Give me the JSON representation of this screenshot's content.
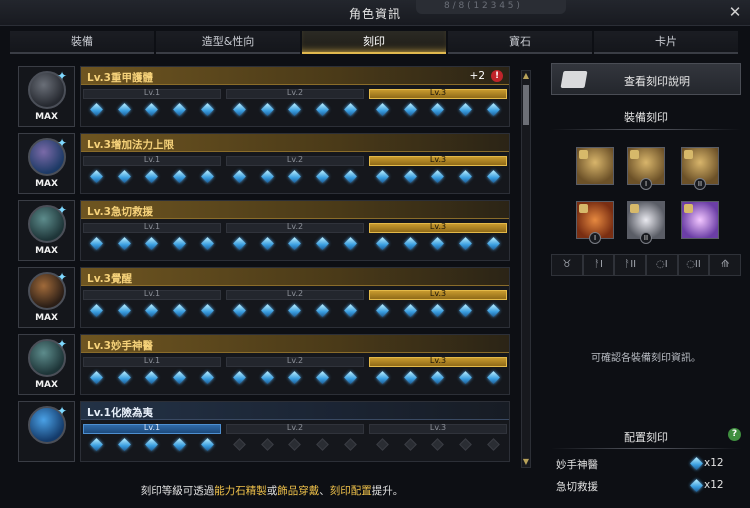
{
  "window": {
    "title": "角色資訊",
    "ghost_text": "8 / 8     ( 1 2 3 4 5 )",
    "close": "✕"
  },
  "tabs": [
    {
      "label": "裝備"
    },
    {
      "label": "造型&性向"
    },
    {
      "label": "刻印",
      "active": true
    },
    {
      "label": "寶石"
    },
    {
      "label": "卡片"
    }
  ],
  "engravings": [
    {
      "name": "Lv.3重甲護體",
      "badge": "MAX",
      "bonus": "+2",
      "warn": "!",
      "levels": [
        "Lv.1",
        "Lv.2",
        "Lv.3"
      ],
      "progress": 3,
      "orb": "gray"
    },
    {
      "name": "Lv.3增加法力上限",
      "badge": "MAX",
      "levels": [
        "Lv.1",
        "Lv.2",
        "Lv.3"
      ],
      "progress": 3,
      "orb": "fire"
    },
    {
      "name": "Lv.3急切救援",
      "badge": "MAX",
      "levels": [
        "Lv.1",
        "Lv.2",
        "Lv.3"
      ],
      "progress": 3,
      "orb": "teal"
    },
    {
      "name": "Lv.3覺醒",
      "badge": "MAX",
      "levels": [
        "Lv.1",
        "Lv.2",
        "Lv.3"
      ],
      "progress": 3,
      "orb": "amber"
    },
    {
      "name": "Lv.3妙手神醫",
      "badge": "MAX",
      "levels": [
        "Lv.1",
        "Lv.2",
        "Lv.3"
      ],
      "progress": 3,
      "orb": "teal"
    },
    {
      "name": "Lv.1化險為夷",
      "badge": "",
      "levels": [
        "Lv.1",
        "Lv.2",
        "Lv.3"
      ],
      "progress": 1,
      "orb": "blue"
    }
  ],
  "side": {
    "explain_label": "查看刻印說明",
    "equip_title": "裝備刻印",
    "slots": [
      {
        "icon": "necklace-icon",
        "tier": ""
      },
      {
        "icon": "earring-icon",
        "tier": "I"
      },
      {
        "icon": "earring-icon",
        "tier": "II"
      },
      {
        "icon": "ring-icon",
        "tier": "I"
      },
      {
        "icon": "ring-icon",
        "tier": "II"
      },
      {
        "icon": "ability-stone-icon",
        "tier": ""
      }
    ],
    "filters": [
      "♉",
      "ᚨI",
      "ᚨII",
      "◌I",
      "◌II",
      "⟰"
    ],
    "info_text": "可確認各裝備刻印資訊。",
    "config_title": "配置刻印",
    "help": "?",
    "config": [
      {
        "name": "妙手神醫",
        "count": "x12"
      },
      {
        "name": "急切救援",
        "count": "x12"
      }
    ]
  },
  "footer": {
    "prefix": "刻印等級可透過",
    "hl1": "能力石精製",
    "mid1": "或",
    "hl2": "飾品穿戴",
    "mid2": "、",
    "hl3": "刻印配置",
    "suffix": "提升。"
  },
  "colors": {
    "gold": "#e1b94f",
    "gem": "#3a9ee0",
    "accent_blue": "#2f6aa8"
  }
}
